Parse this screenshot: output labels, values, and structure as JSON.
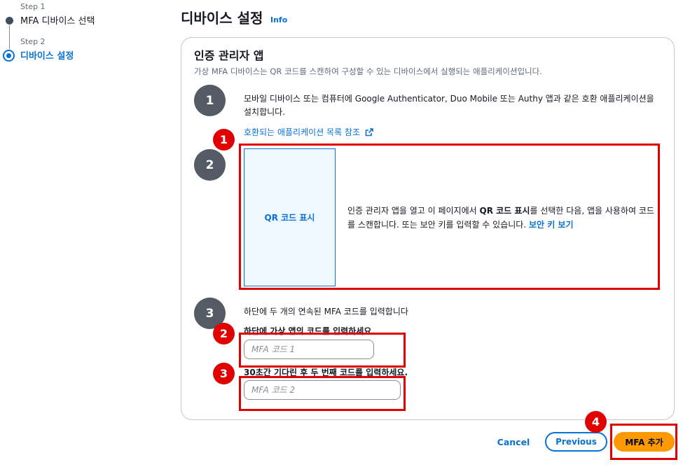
{
  "stepper": {
    "steps": [
      {
        "label": "Step 1",
        "title": "MFA 디바이스 선택"
      },
      {
        "label": "Step 2",
        "title": "디바이스 설정"
      }
    ]
  },
  "header": {
    "title": "디바이스 설정",
    "info": "Info"
  },
  "panel": {
    "title": "인증 관리자 앱",
    "description": "가상 MFA 디바이스는 QR 코드를 스캔하여 구성할 수 있는 디바이스에서 실행되는 애플리케이션입니다.",
    "step1": {
      "number": "1",
      "text": "모바일 디바이스 또는 컴퓨터에 Google Authenticator, Duo Mobile 또는 Authy 앱과 같은 호환 애플리케이션을 설치합니다.",
      "link": "호환되는 애플리케이션 목록 참조"
    },
    "step2": {
      "number": "2",
      "qr_label": "QR 코드 표시",
      "text_before": "인증 관리자 앱을 열고 이 페이지에서 ",
      "text_bold": "QR 코드 표시",
      "text_after": "를 선택한 다음, 앱을 사용하여 코드를 스캔합니다. 또는 보안 키를 입력할 수 있습니다. ",
      "secret_link": "보안 키 보기"
    },
    "step3": {
      "number": "3",
      "text": "하단에 두 개의 연속된 MFA 코드를 입력합니다",
      "field1_label": "하단에 가상 앱의 코드를 입력하세요",
      "field1_placeholder": "MFA 코드 1",
      "field2_label": "30초간 기다린 후 두 번째 코드를 입력하세요.",
      "field2_placeholder": "MFA 코드 2"
    }
  },
  "annotations": [
    "1",
    "2",
    "3",
    "4"
  ],
  "footer": {
    "cancel": "Cancel",
    "previous": "Previous",
    "add": "MFA 추가"
  },
  "colors": {
    "link": "#0972d3",
    "primary_button": "#ff9900",
    "annotation": "#e00000",
    "step_circle": "#545b64"
  },
  "icons": {
    "external_link": "external-link-icon"
  }
}
